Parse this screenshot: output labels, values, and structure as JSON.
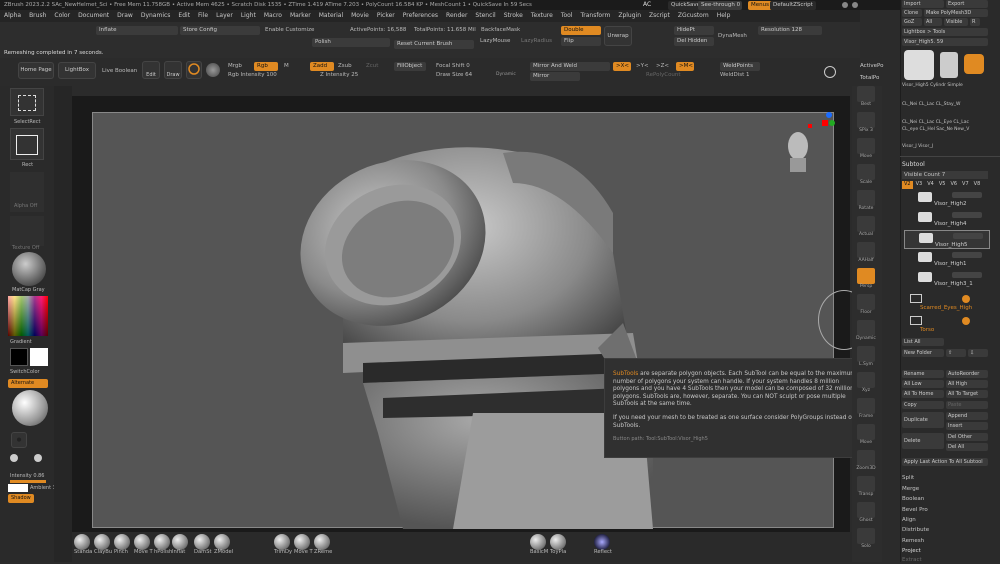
{
  "titlebar": "ZBrush 2023.2.2 SAc_NewHelmet_Sci    •  Free Mem 11.758GB  •  Active Mem 4625  •  Scratch Disk 1535  •  ZTime 1.419  ATime 7.203  •  PolyCount 16.584 KP  •  MeshCount 1  •  QuickSave In 59 Secs",
  "top_right": {
    "ac": "AC",
    "quicksave": "QuickSave",
    "seethrough": "See-through  0",
    "menus": "Menus",
    "script": "DefaultZScript"
  },
  "menus": [
    "Alpha",
    "Brush",
    "Color",
    "Document",
    "Draw",
    "Dynamics",
    "Edit",
    "File",
    "Layer",
    "Light",
    "Macro",
    "Marker",
    "Material",
    "Movie",
    "Picker",
    "Preferences",
    "Render",
    "Stencil",
    "Stroke",
    "Texture",
    "Tool",
    "Transform",
    "Zplugin",
    "Zscript",
    "ZGcustom",
    "Help"
  ],
  "toolbar2": {
    "inflate": "Inflate",
    "inflate_val": "0",
    "store_config": "Store Config",
    "enable_customize": "Enable Customize",
    "active_points": "ActivePoints: 16,588",
    "total_points": "TotalPoints: 11.658 Mil",
    "backface": "BackfaceMask",
    "double": "Double",
    "flip": "Flip",
    "unwrap": "Unwrap",
    "hidept": "HidePt",
    "delhidden": "Del Hidden",
    "dynamesh": "DynaMesh",
    "resolution": "Resolution 128",
    "polish": "Polish",
    "reset_brush": "Reset Current Brush",
    "lazymouse": "LazyMouse",
    "lazyradius": "LazyRadius",
    "status": "Remeshing completed in 7 seconds."
  },
  "toolbar3": {
    "home": "Home Page",
    "lightbox": "LightBox",
    "live_boolean": "Live Boolean",
    "edit": "Edit",
    "draw": "Draw",
    "mrgb": "Mrgb",
    "rgb": "Rgb",
    "m": "M",
    "rgb_intensity": "Rgb Intensity 100",
    "zadd": "Zadd",
    "zsub": "Zsub",
    "zcut": "Zcut",
    "z_intensity": "Z Intensity 25",
    "fillobject": "FillObject",
    "focal_shift": "Focal Shift 0",
    "draw_size": "Draw Size 64",
    "dynamic": "Dynamic",
    "mirror_weld": "Mirror And Weld",
    "mirror": "Mirror",
    "x": ">X<",
    "y": ">Y<",
    "z": ">Z<",
    "m2": ">M<",
    "repolycount": "RePolyCount",
    "weldpoints": "WeldPoints",
    "welddist": "WeldDist 1"
  },
  "left_shelf": {
    "select_rect": "SelectRect",
    "rect": "Rect",
    "alpha_off": "Alpha Off",
    "texture_off": "Texture Off",
    "matcap": "MatCap Gray",
    "gradient": "Gradient",
    "switchcolor": "SwitchColor",
    "alternate": "Alternate",
    "intensity": "Intensity 0.86",
    "ambient": "Ambient 3",
    "shadow": "Shadow"
  },
  "right_shelf": [
    "Best",
    "SPix 3",
    "Move",
    "Scale",
    "Rotate",
    "Actual",
    "AAHalf",
    "Persp",
    "Floor",
    "Dynamic",
    "L.Sym",
    "Xyz",
    "Frame",
    "Move",
    "Zoom3D",
    "Transp",
    "Ghost",
    "Solo"
  ],
  "bottom_brushes": [
    "Standa",
    "ClayBu",
    "Pinch",
    "Move T",
    "hPolish",
    "Inflat",
    "DamSt",
    "ZModel",
    "TrimDy",
    "Move T",
    "ZReme",
    "BasicM",
    "ToyPla",
    "Reflect"
  ],
  "rightpanel": {
    "import": "Import",
    "export": "Export",
    "clone": "Clone",
    "make_polymesh": "Make PolyMesh3D",
    "goz": "GoZ",
    "all": "All",
    "visible": "Visible",
    "r": "R",
    "lightbox_tools": "Lightbox > Tools",
    "visor_high": "Visor_High5. 59",
    "tool_names": "Visor_High5 Cylindr Simple",
    "tool_names2": "CL_Nei CL_Lac CL_Stay_W",
    "tool_names3": "CL_Nei CL_Lac CL_Eye CL_Lac",
    "tool_names4": "CL_eye CL_Hel Sac_Ne New_V",
    "tool_names5": "Visor_J Visor_J",
    "subtool": "Subtool",
    "visible_count": "Visible Count 7",
    "v_tabs": [
      "V2",
      "V3",
      "V4",
      "V5",
      "V6",
      "V7",
      "V8"
    ],
    "subtools": [
      "Visor_High2",
      "Visor_High4",
      "Visor_High5",
      "Visor_High1",
      "Visor_High3_1"
    ],
    "folder1": "Scarred_Eyes_High",
    "folder2": "Torso",
    "list_all": "List All",
    "new_folder": "New Folder",
    "rename": "Rename",
    "autoreorder": "AutoReorder",
    "all_low": "All Low",
    "all_high": "All High",
    "all_to_home": "All To Home",
    "all_to_target": "All To Target",
    "copy": "Copy",
    "paste": "Paste",
    "duplicate": "Duplicate",
    "append": "Append",
    "insert": "Insert",
    "delete": "Delete",
    "del_other": "Del Other",
    "del_all": "Del All",
    "apply_last": "Apply Last Action To All Subtool",
    "split": "Split",
    "merge": "Merge",
    "boolean": "Boolean",
    "bevel_pro": "Bevel Pro",
    "align": "Align",
    "distribute": "Distribute",
    "remesh": "Remesh",
    "project": "Project",
    "extract": "Extract"
  },
  "canvas_side": {
    "activepoints": "ActivePo",
    "totalpoints": "TotalPo"
  },
  "tooltip": {
    "title": "SubTools",
    "line1": " are separate polygon objects. Each SubTool can be equal to the maximum number of polygons your system can handle. If your system handles 8 million polygons and you have 4 SubTools then your model can be composed of 32 million polygons. SubTools are, however, separate. You can NOT sculpt or pose multiple SubTools at the same time.",
    "line2": "If you need your mesh to be treated as one surface consider PolyGroups instead of SubTools.",
    "path": "Button path: Tool:SubTool:Visor_High5"
  },
  "colors": {
    "accent": "#e08a22",
    "bg": "#2b2b2b",
    "canvas": "#555555"
  }
}
